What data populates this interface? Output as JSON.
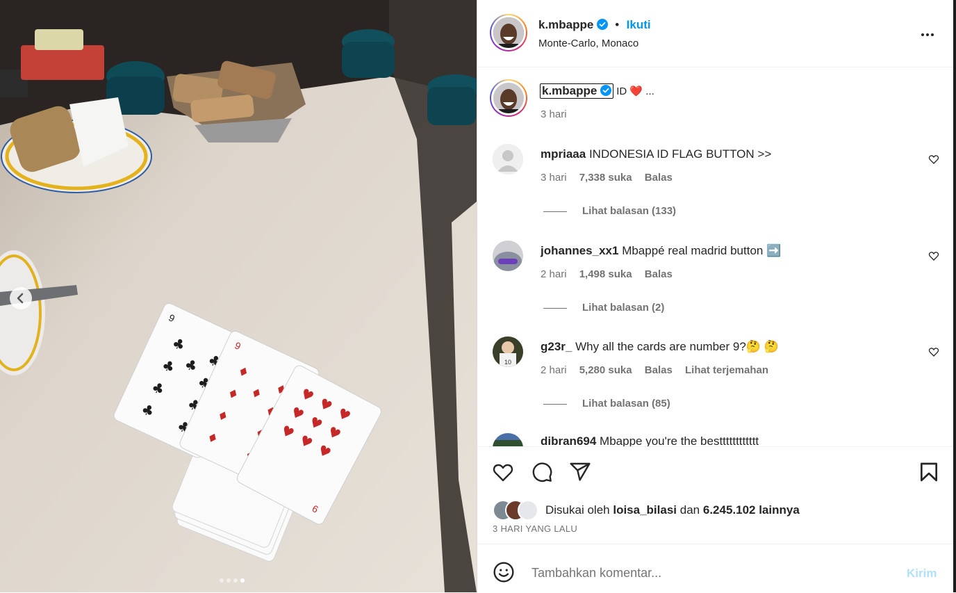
{
  "post": {
    "username": "k.mbappe",
    "follow_label": "Ikuti",
    "location": "Monte-Carlo, Monaco",
    "more_icon": "more-horizontal-icon",
    "slides": {
      "count": 4,
      "active": 4
    }
  },
  "caption": {
    "username": "k.mbappe",
    "text": "ID ❤️ ...",
    "time": "3 hari"
  },
  "comments": [
    {
      "username": "mpriaaa",
      "text": "INDONESIA ID FLAG BUTTON >>",
      "time": "3 hari",
      "likes": "7,338 suka",
      "reply": "Balas",
      "translate": "",
      "replies": "Lihat balasan (133)"
    },
    {
      "username": "johannes_xx1",
      "text": "Mbappé real madrid button ➡️",
      "time": "2 hari",
      "likes": "1,498 suka",
      "reply": "Balas",
      "translate": "",
      "replies": "Lihat balasan (2)"
    },
    {
      "username": "g23r_",
      "text": "Why all the cards are number 9?🤔 🤔",
      "time": "2 hari",
      "likes": "5,280 suka",
      "reply": "Balas",
      "translate": "Lihat terjemahan",
      "replies": "Lihat balasan (85)"
    },
    {
      "username": "dibran694",
      "text": "Mbappe you're the bestttttttttttt"
    }
  ],
  "likes": {
    "prefix": "Disukai oleh",
    "user": "loisa_bilasi",
    "conj": "dan",
    "count": "6.245.102 lainnya"
  },
  "date": "3 HARI YANG LALU",
  "add_comment": {
    "placeholder": "Tambahkan komentar...",
    "post_label": "Kirim"
  },
  "colors": {
    "accent": "#0095f6",
    "verified": "#0095f6",
    "muted": "#737373",
    "post_disabled": "#b2dffc"
  }
}
